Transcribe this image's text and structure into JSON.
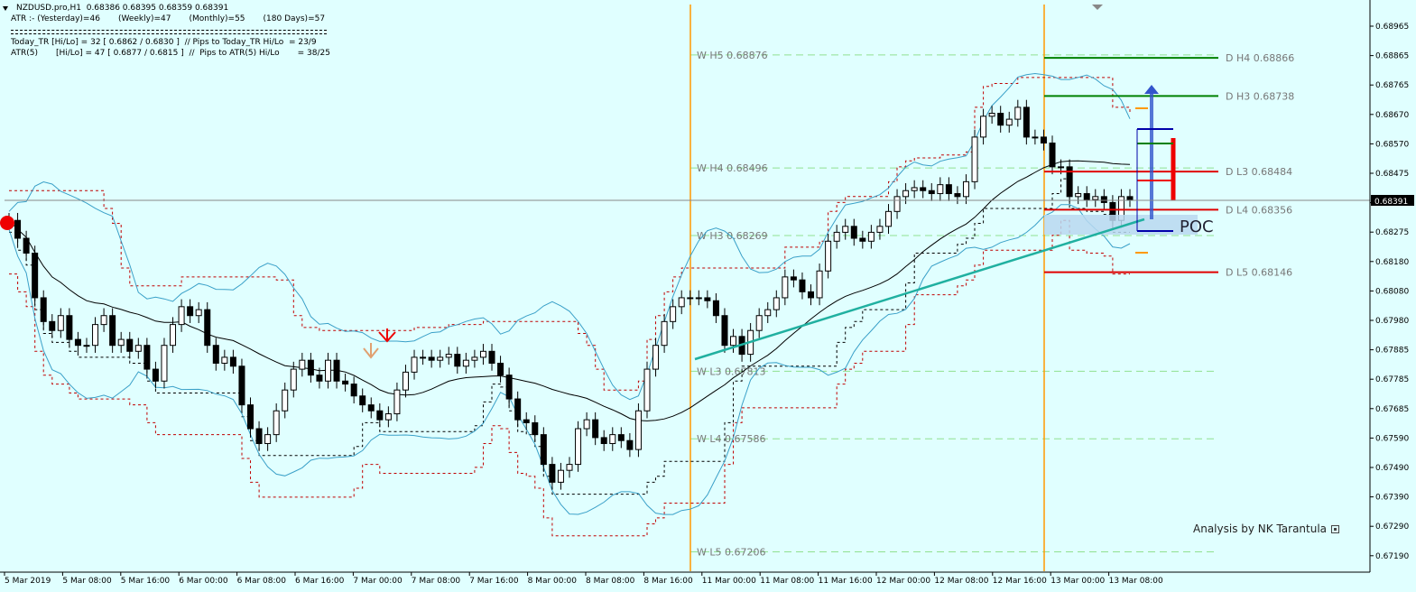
{
  "header": {
    "symbol_line": "NZDUSD.pro,H1  0.68386 0.68395 0.68359 0.68391",
    "atr_line": "ATR :- (Yesterday)=46       (Weekly)=47       (Monthly)=55       (180 Days)=57",
    "today_tr_line": "Today_TR [Hi/Lo] = 32 [ 0.6862 / 0.6830 ]  // Pips to Today_TR Hi/Lo  = 23/9",
    "atr5_line": "ATR(5)       [Hi/Lo] = 47 [ 0.6877 / 0.6815 ]  //  Pips to ATR(5) Hi/Lo       = 38/25"
  },
  "price_scale": {
    "labels": [
      "0.68965",
      "0.68865",
      "0.68765",
      "0.68670",
      "0.68570",
      "0.68475",
      "0.68375",
      "0.68275",
      "0.68180",
      "0.68080",
      "0.67980",
      "0.67885",
      "0.67785",
      "0.67685",
      "0.67590",
      "0.67490",
      "0.67390",
      "0.67290",
      "0.67190"
    ],
    "current_price": "0.68391"
  },
  "time_axis": {
    "labels": [
      "5 Mar 2019",
      "5 Mar 08:00",
      "5 Mar 16:00",
      "6 Mar 00:00",
      "6 Mar 08:00",
      "6 Mar 16:00",
      "7 Mar 00:00",
      "7 Mar 08:00",
      "7 Mar 16:00",
      "8 Mar 00:00",
      "8 Mar 08:00",
      "8 Mar 16:00",
      "11 Mar 00:00",
      "11 Mar 08:00",
      "11 Mar 16:00",
      "12 Mar 00:00",
      "12 Mar 08:00",
      "12 Mar 16:00",
      "13 Mar 00:00",
      "13 Mar 08:00"
    ]
  },
  "weekly_pivots": [
    {
      "label": "W  H5 0.68876",
      "price": 0.68876
    },
    {
      "label": "W  H4 0.68496",
      "price": 0.68496
    },
    {
      "label": "W  H3 0.68269",
      "price": 0.68269
    },
    {
      "label": "W  L3 0.67813",
      "price": 0.67813
    },
    {
      "label": "W  L4 0.67586",
      "price": 0.67586
    },
    {
      "label": "W  L5 0.67206",
      "price": 0.67206
    }
  ],
  "daily_pivots": [
    {
      "label": "D  H4 0.68866",
      "price": 0.68866,
      "color": "#008000"
    },
    {
      "label": "D  H3 0.68738",
      "price": 0.68738,
      "color": "#008000"
    },
    {
      "label": "D  L3 0.68484",
      "price": 0.68484,
      "color": "#E00000"
    },
    {
      "label": "D  L4 0.68356",
      "price": 0.68356,
      "color": "#E00000"
    },
    {
      "label": "D  L5 0.68146",
      "price": 0.68146,
      "color": "#E00000"
    }
  ],
  "poc_label": "POC",
  "credit": "Analysis by NK Tarantula",
  "colors": {
    "background": "#E0FFFF",
    "bollinger": "#3AA0C8",
    "moving_average": "#000000",
    "envelope_dashed": "#C00000",
    "session_separator": "#FF9900",
    "trendline": "#20B0A0",
    "poc_box": "#B8D8F0",
    "arrow_up": "#3355CC",
    "bar_red": "#EE0000"
  },
  "chart_data": {
    "type": "candlestick",
    "title": "NZDUSD.pro,H1",
    "ylim": [
      0.6715,
      0.69
    ],
    "close_series": [
      0.6832,
      0.6826,
      0.6821,
      0.6806,
      0.6798,
      0.6795,
      0.68,
      0.6792,
      0.679,
      0.679,
      0.6797,
      0.68,
      0.679,
      0.6792,
      0.6788,
      0.679,
      0.6782,
      0.6778,
      0.679,
      0.6797,
      0.6803,
      0.68,
      0.6802,
      0.679,
      0.6784,
      0.6786,
      0.6783,
      0.677,
      0.6762,
      0.6757,
      0.676,
      0.6768,
      0.6775,
      0.6782,
      0.6785,
      0.678,
      0.6778,
      0.6785,
      0.6778,
      0.6777,
      0.6773,
      0.677,
      0.6768,
      0.6765,
      0.6767,
      0.6775,
      0.6781,
      0.6786,
      0.6786,
      0.6785,
      0.6786,
      0.6787,
      0.6783,
      0.6785,
      0.6786,
      0.6788,
      0.6784,
      0.678,
      0.6772,
      0.6765,
      0.6764,
      0.676,
      0.675,
      0.6744,
      0.6748,
      0.675,
      0.6762,
      0.6765,
      0.6759,
      0.6757,
      0.676,
      0.6758,
      0.6755,
      0.6768,
      0.6782,
      0.679,
      0.6798,
      0.6803,
      0.6806,
      0.6806,
      0.6806,
      0.6805,
      0.68,
      0.679,
      0.6793,
      0.6787,
      0.6795,
      0.68,
      0.6802,
      0.6806,
      0.6813,
      0.6812,
      0.6808,
      0.6806,
      0.6815,
      0.6825,
      0.6828,
      0.683,
      0.6826,
      0.6825,
      0.6828,
      0.683,
      0.6835,
      0.684,
      0.6842,
      0.6843,
      0.6842,
      0.6841,
      0.6844,
      0.6841,
      0.684,
      0.6845,
      0.686,
      0.6867,
      0.6868,
      0.6864,
      0.6866,
      0.687,
      0.686,
      0.686,
      0.6858,
      0.685,
      0.685,
      0.684,
      0.6841,
      0.6839,
      0.684,
      0.6838,
      0.6832,
      0.684,
      0.6839
    ]
  }
}
